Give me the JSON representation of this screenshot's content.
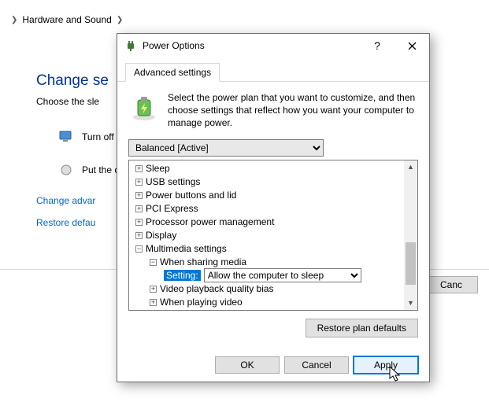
{
  "breadcrumb": {
    "item1": "Hardware and Sound"
  },
  "cp": {
    "heading": "Change se",
    "sub": "Choose the sle",
    "row1": "Turn off t",
    "row2": "Put the co",
    "link1": "Change advar",
    "link2": "Restore defau"
  },
  "bg_buttons": {
    "cancel": "Canc"
  },
  "dialog": {
    "title": "Power Options",
    "tab": "Advanced settings",
    "intro": "Select the power plan that you want to customize, and then choose settings that reflect how you want your computer to manage power.",
    "plan": "Balanced [Active]",
    "tree": {
      "sleep": "Sleep",
      "usb": "USB settings",
      "power_buttons": "Power buttons and lid",
      "pci": "PCI Express",
      "processor": "Processor power management",
      "display": "Display",
      "multimedia": "Multimedia settings",
      "when_sharing": "When sharing media",
      "setting_label": "Setting:",
      "setting_value": "Allow the computer to sleep",
      "video_playback": "Video playback quality bias",
      "when_playing": "When playing video"
    },
    "restore": "Restore plan defaults",
    "ok": "OK",
    "cancel": "Cancel",
    "apply": "Apply"
  }
}
